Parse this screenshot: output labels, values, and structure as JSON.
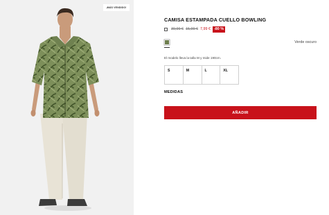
{
  "product": {
    "badge": "¡MÁS VENDIDO!",
    "title": "CAMISA ESTAMPADA CUELLO BOWLING",
    "price_original": "39,99 €",
    "price_previous": "15,99 €",
    "price_current": "7,99 €",
    "discount": "-80 %",
    "color_name": "Verde oscuro",
    "swatch_color": "#6e7f4e",
    "model_info": "El modelo lleva la talla M y mide 190cm.",
    "sizes": [
      "S",
      "M",
      "L",
      "XL"
    ],
    "measures_label": "MEDIDAS",
    "add_button_label": "AÑADIR"
  },
  "colors": {
    "accent": "#c8121b",
    "photo_background": "#f1f1f1"
  }
}
